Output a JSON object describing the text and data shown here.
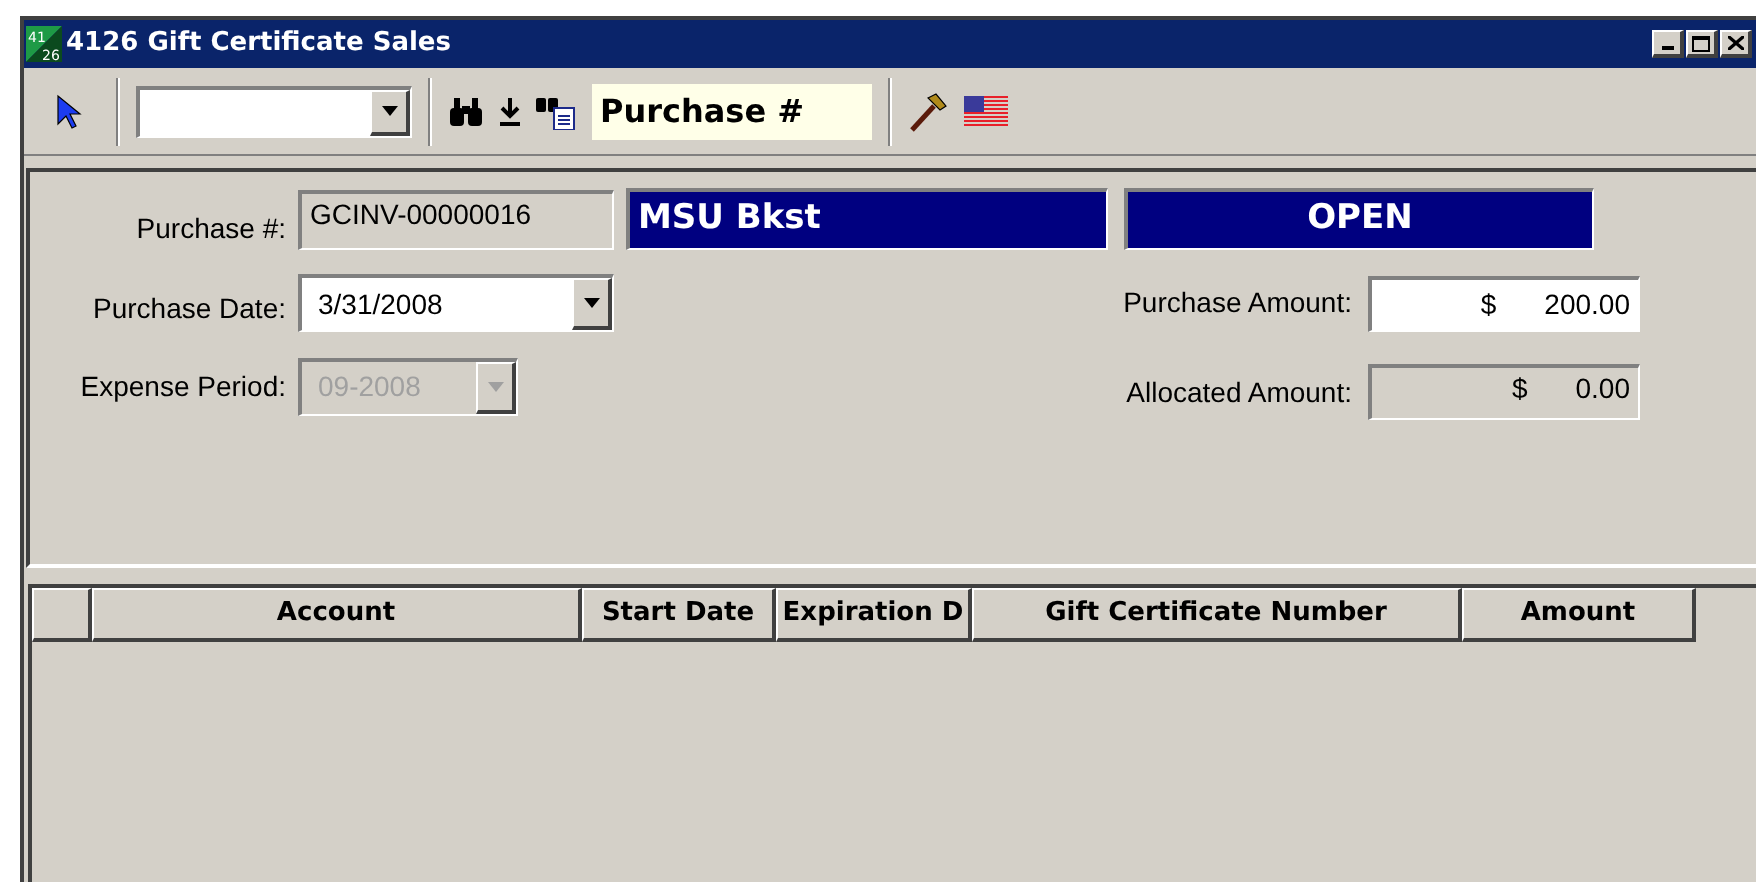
{
  "window": {
    "title": "4126 Gift Certificate Sales",
    "icon_text": [
      "41",
      "26"
    ]
  },
  "toolbar": {
    "search_field": {
      "value": "Purchase #"
    }
  },
  "form": {
    "purchase_number": {
      "label": "Purchase #:",
      "value": "GCINV-00000016"
    },
    "vendor": "MSU Bkst",
    "status": "OPEN",
    "purchase_date": {
      "label": "Purchase Date:",
      "value": "3/31/2008",
      "disabled": false
    },
    "expense_period": {
      "label": "Expense Period:",
      "value": "09-2008",
      "disabled": true
    },
    "purchase_amount": {
      "label": "Purchase Amount:",
      "currency": "$",
      "value": "200.00",
      "disabled": false
    },
    "allocated_amount": {
      "label": "Allocated Amount:",
      "currency": "$",
      "value": "0.00",
      "disabled": true
    }
  },
  "table": {
    "columns": [
      "Account",
      "Start Date",
      "Expiration D",
      "Gift Certificate Number",
      "Amount"
    ]
  }
}
